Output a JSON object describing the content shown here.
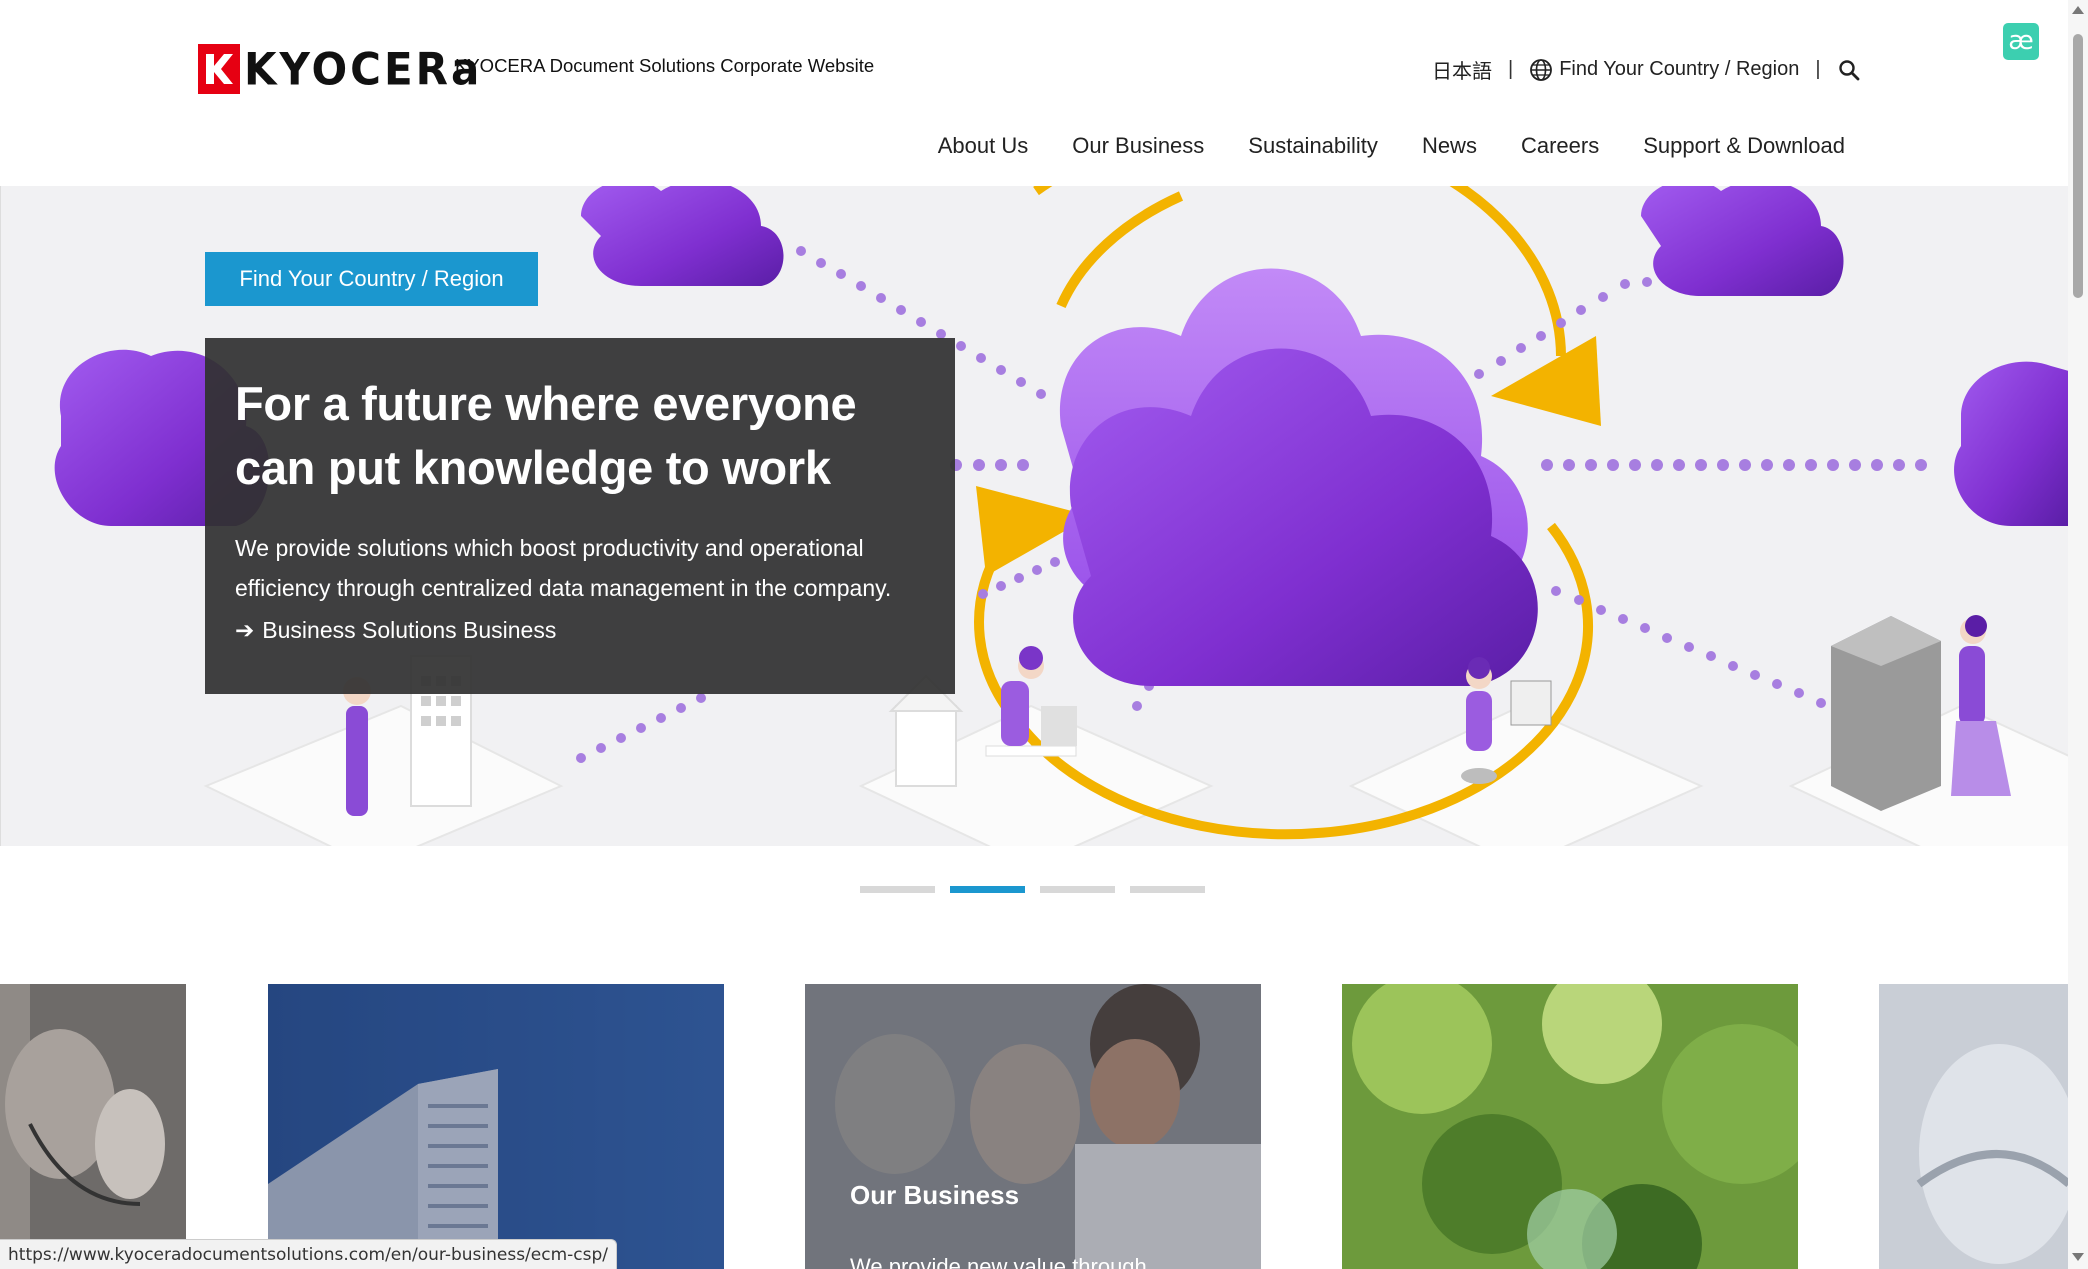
{
  "header": {
    "logo_text": "KYOCERa",
    "site_title": "KYOCERA Document Solutions Corporate Website",
    "language_link": "日本語",
    "region_link": "Find Your Country / Region",
    "separator": "|",
    "extension_badge": "æ"
  },
  "nav": {
    "items": [
      {
        "label": "About Us"
      },
      {
        "label": "Our Business"
      },
      {
        "label": "Sustainability"
      },
      {
        "label": "News"
      },
      {
        "label": "Careers"
      },
      {
        "label": "Support & Download"
      }
    ]
  },
  "hero": {
    "region_button": "Find Your Country / Region",
    "title_line1": "For a future where everyone",
    "title_line2": "can put knowledge to work",
    "desc_line1": "We provide solutions which boost productivity and operational",
    "desc_line2": "efficiency through centralized data management in the company.",
    "link_arrow": "➔",
    "link_label": "Business Solutions Business"
  },
  "pager": {
    "count": 4,
    "active_index": 1
  },
  "cards": [
    {
      "label": ""
    },
    {
      "label": ""
    },
    {
      "label": "Our Business",
      "sub": "We provide new value through"
    },
    {
      "label": ""
    },
    {
      "label": ""
    }
  ],
  "status_bar": {
    "url": "https://www.kyoceradocumentsolutions.com/en/our-business/ecm-csp/"
  },
  "colors": {
    "brand_red": "#e60012",
    "accent_blue": "#1b97cf",
    "cloud_purple": "#8b3fd6",
    "ring_yellow": "#f3b300",
    "panel_dark": "#323232"
  }
}
